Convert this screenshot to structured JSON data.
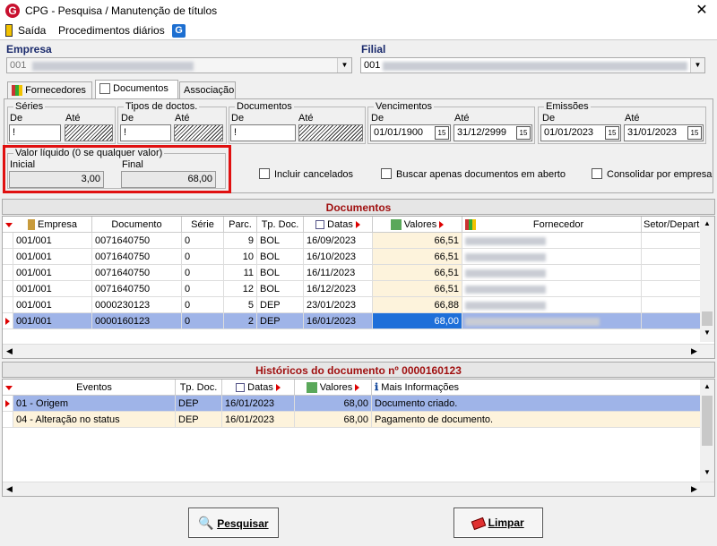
{
  "window": {
    "title": "CPG - Pesquisa / Manutenção de títulos",
    "close": "✕"
  },
  "menu": {
    "exit": "Saída",
    "daily": "Procedimentos diários"
  },
  "empresa": {
    "label": "Empresa",
    "value": "001"
  },
  "filial": {
    "label": "Filial",
    "value": "001"
  },
  "tabs": [
    {
      "label": "Fornecedores"
    },
    {
      "label": "Documentos"
    },
    {
      "label": "Associação"
    }
  ],
  "filters": {
    "series": {
      "legend": "Séries",
      "de": "De",
      "ate": "Até",
      "de_value": "!"
    },
    "tipos": {
      "legend": "Tipos de doctos.",
      "de": "De",
      "ate": "Até",
      "de_value": "!"
    },
    "documentos": {
      "legend": "Documentos",
      "de": "De",
      "ate": "Até",
      "de_value": "!"
    },
    "vencimentos": {
      "legend": "Vencimentos",
      "de": "De",
      "ate": "Até",
      "de_value": "01/01/1900",
      "ate_value": "31/12/2999"
    },
    "emissoes": {
      "legend": "Emissões",
      "de": "De",
      "ate": "Até",
      "de_value": "01/01/2023",
      "ate_value": "31/01/2023"
    },
    "valor": {
      "legend": "Valor líquido (0 se qualquer valor)",
      "inicial": "Inicial",
      "final": "Final",
      "inicial_value": "3,00",
      "final_value": "68,00"
    },
    "checks": {
      "cancelados": "Incluir cancelados",
      "abertos": "Buscar apenas documentos em aberto",
      "consolidar": "Consolidar por empresa"
    },
    "cal": "15"
  },
  "documentos": {
    "title": "Documentos",
    "columns": [
      "Empresa",
      "Documento",
      "Série",
      "Parc.",
      "Tp. Doc.",
      "Datas",
      "Valores",
      "Fornecedor",
      "Setor/Depart"
    ],
    "rows": [
      [
        "001/001",
        "0071640750",
        "0",
        "9",
        "BOL",
        "16/09/2023",
        "66,51"
      ],
      [
        "001/001",
        "0071640750",
        "0",
        "10",
        "BOL",
        "16/10/2023",
        "66,51"
      ],
      [
        "001/001",
        "0071640750",
        "0",
        "11",
        "BOL",
        "16/11/2023",
        "66,51"
      ],
      [
        "001/001",
        "0071640750",
        "0",
        "12",
        "BOL",
        "16/12/2023",
        "66,51"
      ],
      [
        "001/001",
        "0000230123",
        "0",
        "5",
        "DEP",
        "23/01/2023",
        "66,88"
      ],
      [
        "001/001",
        "0000160123",
        "0",
        "2",
        "DEP",
        "16/01/2023",
        "68,00"
      ]
    ]
  },
  "historicos": {
    "title": "Históricos do documento nº 0000160123",
    "columns": [
      "Eventos",
      "Tp. Doc.",
      "Datas",
      "Valores",
      "Mais Informações"
    ],
    "rows": [
      [
        "01 - Origem",
        "DEP",
        "16/01/2023",
        "68,00",
        "Documento criado."
      ],
      [
        "04 - Alteração no status",
        "DEP",
        "16/01/2023",
        "68,00",
        "Pagamento de documento."
      ]
    ]
  },
  "buttons": {
    "pesquisar": "Pesquisar",
    "limpar": "Limpar"
  },
  "colors": {
    "selected_row": "#9fb4e8",
    "highlight_cell": "#1e6fd9",
    "alt_row": "#fdf3dc",
    "section_title": "#a01010",
    "red_box": "#e01010"
  }
}
